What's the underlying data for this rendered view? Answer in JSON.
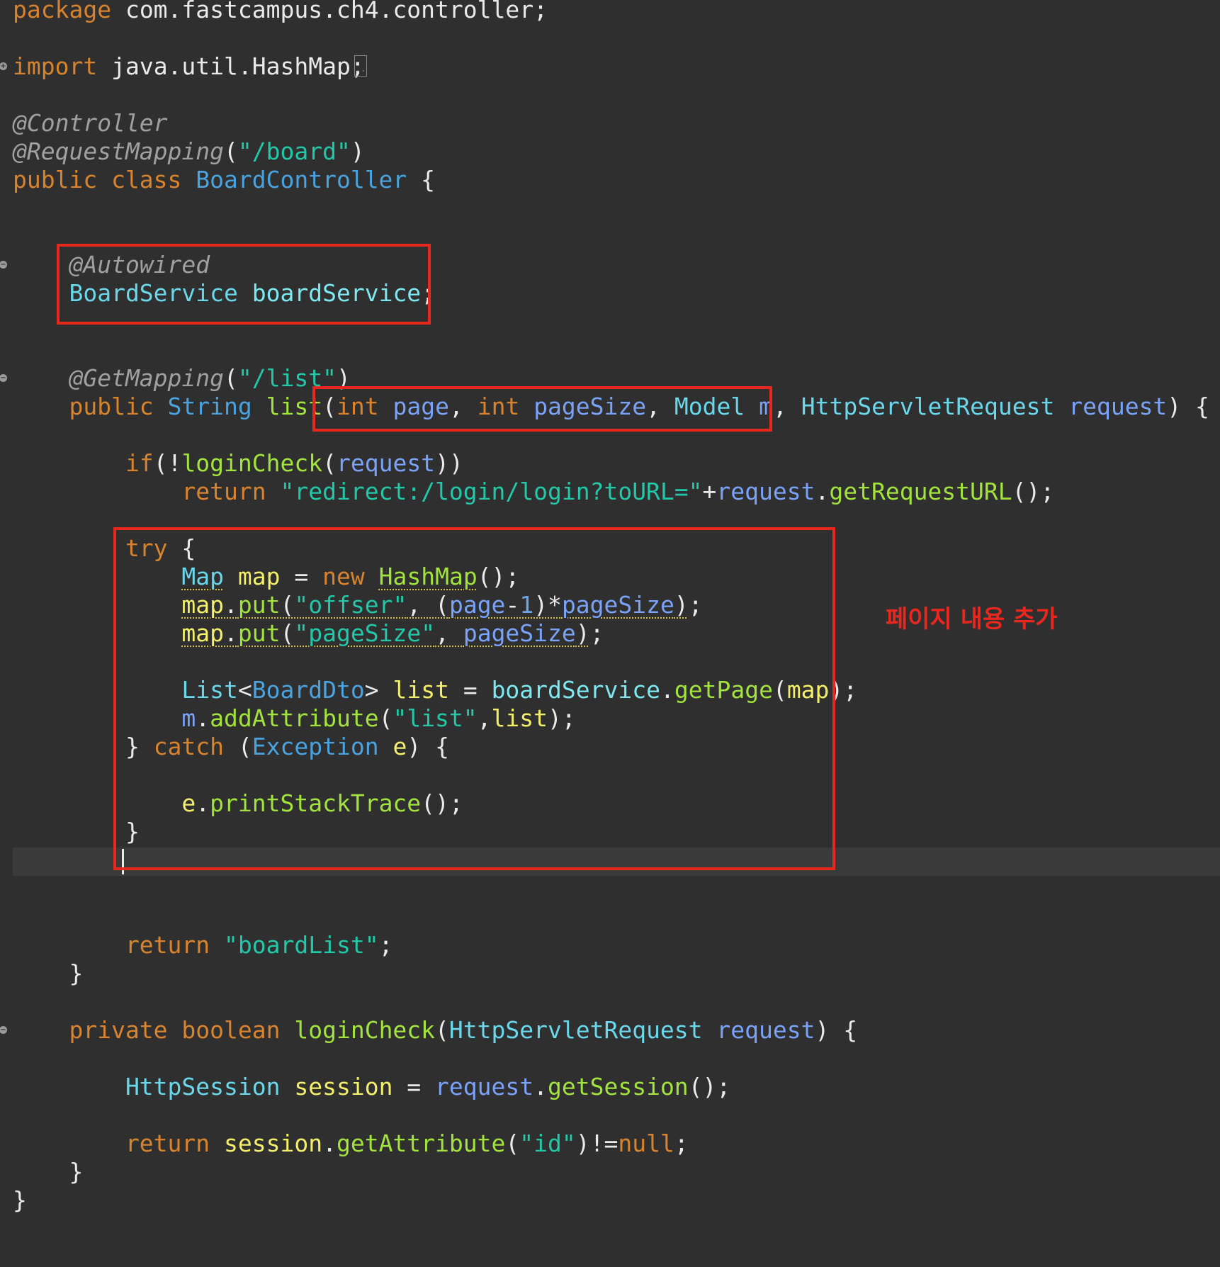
{
  "editor": {
    "lines": [
      [
        [
          "t-kw",
          "package"
        ],
        [
          "t-ident",
          " com.fastcampus.ch4.controller;"
        ]
      ],
      [
        [
          "t-kw",
          "import"
        ],
        [
          "t-ident",
          " java.util.HashMap;"
        ]
      ],
      [
        [
          "t-ann",
          "@Controller"
        ]
      ],
      [
        [
          "t-ann",
          "@RequestMapping"
        ],
        [
          "t-punct",
          "("
        ],
        [
          "t-str",
          "\"/board\""
        ],
        [
          "t-punct",
          ")"
        ]
      ],
      [
        [
          "t-kw",
          "public class "
        ],
        [
          "t-type",
          "BoardController"
        ],
        [
          "t-punct",
          " {"
        ]
      ],
      [
        [
          "t-ann",
          "    @Autowired"
        ]
      ],
      [
        [
          "t-type2",
          "    BoardService "
        ],
        [
          "t-field",
          "boardService"
        ],
        [
          "t-punct",
          ";"
        ]
      ],
      [
        [
          "t-ann",
          "    @GetMapping"
        ],
        [
          "t-punct",
          "("
        ],
        [
          "t-str",
          "\"/list\""
        ],
        [
          "t-punct",
          ")"
        ]
      ],
      [
        [
          "t-kw",
          "    public "
        ],
        [
          "t-type",
          "String "
        ],
        [
          "t-method",
          "list"
        ],
        [
          "t-punct",
          "("
        ],
        [
          "t-kw",
          "int "
        ],
        [
          "t-param",
          "page"
        ],
        [
          "t-punct",
          ", "
        ],
        [
          "t-kw",
          "int "
        ],
        [
          "t-param",
          "pageSize"
        ],
        [
          "t-punct",
          ", "
        ],
        [
          "t-type2",
          "Model "
        ],
        [
          "t-param",
          "m"
        ],
        [
          "t-punct",
          ", "
        ],
        [
          "t-type2",
          "HttpServletRequest "
        ],
        [
          "t-param",
          "request"
        ],
        [
          "t-punct",
          ") {"
        ]
      ],
      [
        [
          "t-kw",
          "        if"
        ],
        [
          "t-punct",
          "(!"
        ],
        [
          "t-method",
          "loginCheck"
        ],
        [
          "t-punct",
          "("
        ],
        [
          "t-param",
          "request"
        ],
        [
          "t-punct",
          "))"
        ]
      ],
      [
        [
          "t-kw",
          "            return "
        ],
        [
          "t-str",
          "\"redirect:/login/login?toURL=\""
        ],
        [
          "t-punct",
          "+"
        ],
        [
          "t-param",
          "request"
        ],
        [
          "t-punct",
          "."
        ],
        [
          "t-method",
          "getRequestURL"
        ],
        [
          "t-punct",
          "();"
        ]
      ],
      [
        [
          "t-kw",
          "        try"
        ],
        [
          "t-punct",
          " {"
        ]
      ],
      [
        [
          "t-punct",
          "            "
        ],
        [
          "t-type2 t-warn",
          "Map"
        ],
        [
          "t-punct",
          " "
        ],
        [
          "t-local",
          "map"
        ],
        [
          "t-punct",
          " = "
        ],
        [
          "t-kw",
          "new "
        ],
        [
          "t-method t-warn",
          "HashMap"
        ],
        [
          "t-punct",
          "();"
        ]
      ],
      [
        [
          "t-punct",
          "            "
        ],
        [
          "t-local t-warn",
          "map"
        ],
        [
          "t-punct t-warn",
          "."
        ],
        [
          "t-method t-warn",
          "put"
        ],
        [
          "t-punct t-warn",
          "("
        ],
        [
          "t-str t-warn",
          "\"offser\""
        ],
        [
          "t-punct t-warn",
          ", ("
        ],
        [
          "t-param t-warn",
          "page"
        ],
        [
          "t-punct t-warn",
          "-"
        ],
        [
          "t-num t-warn",
          "1"
        ],
        [
          "t-punct t-warn",
          ")*"
        ],
        [
          "t-param t-warn",
          "pageSize"
        ],
        [
          "t-punct t-warn",
          ")"
        ],
        [
          "t-punct",
          ";"
        ]
      ],
      [
        [
          "t-punct",
          "            "
        ],
        [
          "t-local t-warn",
          "map"
        ],
        [
          "t-punct t-warn",
          "."
        ],
        [
          "t-method t-warn",
          "put"
        ],
        [
          "t-punct t-warn",
          "("
        ],
        [
          "t-str t-warn",
          "\"pageSize\""
        ],
        [
          "t-punct t-warn",
          ", "
        ],
        [
          "t-param t-warn",
          "pageSize"
        ],
        [
          "t-punct t-warn",
          ")"
        ],
        [
          "t-punct",
          ";"
        ]
      ],
      [
        [
          "t-type2",
          "            List"
        ],
        [
          "t-punct",
          "<"
        ],
        [
          "t-type",
          "BoardDto"
        ],
        [
          "t-punct",
          "> "
        ],
        [
          "t-local",
          "list"
        ],
        [
          "t-punct",
          " = "
        ],
        [
          "t-field",
          "boardService"
        ],
        [
          "t-punct",
          "."
        ],
        [
          "t-method",
          "getPage"
        ],
        [
          "t-punct",
          "("
        ],
        [
          "t-local",
          "map"
        ],
        [
          "t-punct",
          ");"
        ]
      ],
      [
        [
          "t-param",
          "            m"
        ],
        [
          "t-punct",
          "."
        ],
        [
          "t-method",
          "addAttribute"
        ],
        [
          "t-punct",
          "("
        ],
        [
          "t-str",
          "\"list\""
        ],
        [
          "t-punct",
          ","
        ],
        [
          "t-local",
          "list"
        ],
        [
          "t-punct",
          ");"
        ]
      ],
      [
        [
          "t-punct",
          "        } "
        ],
        [
          "t-kw",
          "catch"
        ],
        [
          "t-punct",
          " ("
        ],
        [
          "t-type",
          "Exception "
        ],
        [
          "t-local",
          "e"
        ],
        [
          "t-punct",
          ") {"
        ]
      ],
      [
        [
          "t-local",
          "            e"
        ],
        [
          "t-punct",
          "."
        ],
        [
          "t-method",
          "printStackTrace"
        ],
        [
          "t-punct",
          "();"
        ]
      ],
      [
        [
          "t-punct",
          "        }"
        ]
      ],
      [
        [
          "t-kw",
          "        return "
        ],
        [
          "t-str",
          "\"boardList\""
        ],
        [
          "t-punct",
          ";"
        ]
      ],
      [
        [
          "t-punct",
          "    }"
        ]
      ],
      [
        [
          "t-kw",
          "    private boolean "
        ],
        [
          "t-method",
          "loginCheck"
        ],
        [
          "t-punct",
          "("
        ],
        [
          "t-type2",
          "HttpServletRequest "
        ],
        [
          "t-param",
          "request"
        ],
        [
          "t-punct",
          ") {"
        ]
      ],
      [
        [
          "t-type2",
          "        HttpSession "
        ],
        [
          "t-local",
          "session"
        ],
        [
          "t-punct",
          " = "
        ],
        [
          "t-param",
          "request"
        ],
        [
          "t-punct",
          "."
        ],
        [
          "t-method",
          "getSession"
        ],
        [
          "t-punct",
          "();"
        ]
      ],
      [
        [
          "t-kw",
          "        return "
        ],
        [
          "t-local",
          "session"
        ],
        [
          "t-punct",
          "."
        ],
        [
          "t-method",
          "getAttribute"
        ],
        [
          "t-punct",
          "("
        ],
        [
          "t-str",
          "\"id\""
        ],
        [
          "t-punct",
          ")!="
        ],
        [
          "t-kw",
          "null"
        ],
        [
          "t-punct",
          ";"
        ]
      ],
      [
        [
          "t-punct",
          "    }"
        ]
      ],
      [
        [
          "t-punct",
          "}"
        ]
      ]
    ]
  },
  "annotation": {
    "note": "페이지 내용 추가"
  },
  "colors": {
    "background": "#2f2f2f",
    "keyword": "#d8842f",
    "string": "#22c8a8",
    "highlight": "#e8281e"
  }
}
